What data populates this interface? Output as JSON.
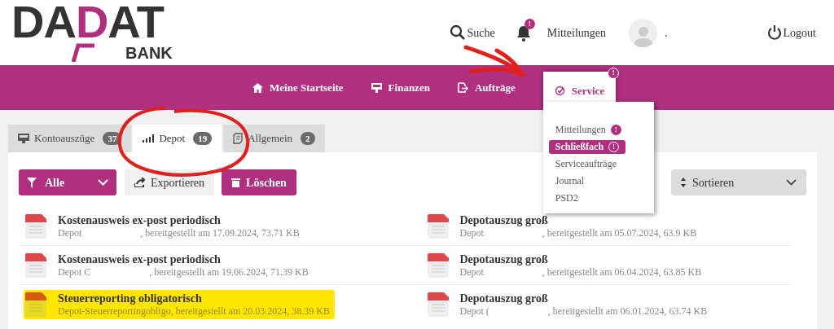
{
  "logo": {
    "parts": [
      {
        "text": "DA",
        "accent": false
      },
      {
        "text": "D",
        "accent": true
      },
      {
        "text": "AT",
        "accent": false
      }
    ],
    "subtitle": "BANK"
  },
  "header": {
    "search": "Suche",
    "notifications": {
      "label": "Mitteilungen",
      "badge": "!"
    },
    "user": ".",
    "logout": "Logout"
  },
  "nav": [
    {
      "label": "Meine Startseite",
      "selected": false
    },
    {
      "label": "Finanzen",
      "selected": false
    },
    {
      "label": "Aufträge",
      "selected": false
    },
    {
      "label": "Service",
      "selected": true,
      "badge": "!"
    }
  ],
  "service_menu": [
    {
      "label": "Mitteilungen",
      "selected": false,
      "badge": "!"
    },
    {
      "label": "Schließfach",
      "selected": true,
      "badge": "!"
    },
    {
      "label": "Serviceaufträge",
      "selected": false
    },
    {
      "label": "Journal",
      "selected": false
    },
    {
      "label": "PSD2",
      "selected": false
    }
  ],
  "tabs": [
    {
      "label": "Kontoauszüge",
      "count": "37",
      "selected": false
    },
    {
      "label": "Depot",
      "count": "19",
      "selected": true
    },
    {
      "label": "Allgemein",
      "count": "2",
      "selected": false
    }
  ],
  "toolbar": {
    "filter": "Alle",
    "export": "Exportieren",
    "delete": "Löschen",
    "sort": "Sortieren"
  },
  "documents": [
    {
      "title": "Kostenausweis ex-post periodisch",
      "account": "Depot",
      "details": ", bereitgestellt am 17.09.2024, 73.71 KB",
      "highlighted": false
    },
    {
      "title": "Depotauszug groß",
      "account": "Depot",
      "details": ", bereitgestellt am 05.07.2024, 63.9 KB",
      "highlighted": false
    },
    {
      "title": "Kostenausweis ex-post periodisch",
      "account": "Depot C",
      "details": ", bereitgestellt am 19.06.2024, 71.39 KB",
      "highlighted": false
    },
    {
      "title": "Depotauszug groß",
      "account": "Depot",
      "details": ", bereitgestellt am 06.04.2024, 63.85 KB",
      "highlighted": false
    },
    {
      "title": "Steuerreporting obligatorisch",
      "account": "Depot-Steuerreportingobligo",
      "details": ", bereitgestellt am 20.03.2024, 38.39 KB",
      "highlighted": true
    },
    {
      "title": "Depotauszug groß",
      "account": "Depot (",
      "details": ", bereitgestellt am 06.01.2024, 63.74 KB",
      "highlighted": false
    }
  ]
}
